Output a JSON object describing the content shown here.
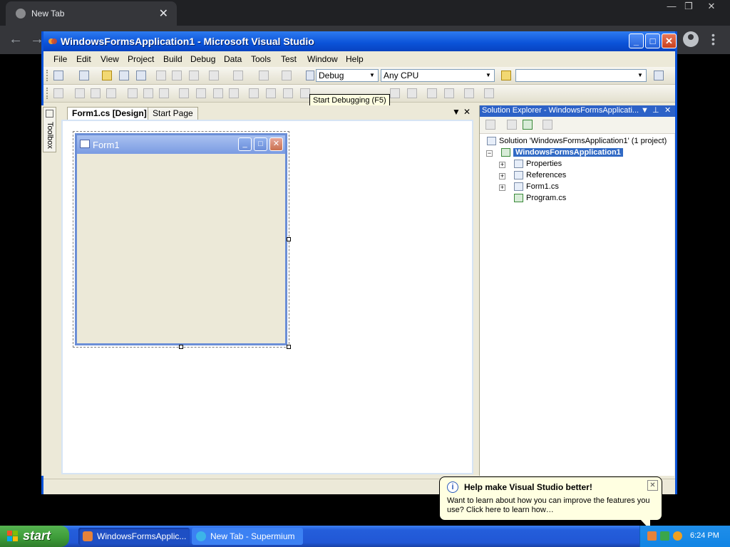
{
  "browser": {
    "tab_title": "New Tab",
    "tab_close": "✕",
    "min": "—",
    "restore": "❐",
    "close": "✕",
    "back": "←",
    "forward": "→"
  },
  "vs": {
    "title": "WindowsFormsApplication1 - Microsoft Visual Studio",
    "menu": [
      "File",
      "Edit",
      "View",
      "Project",
      "Build",
      "Debug",
      "Data",
      "Tools",
      "Test",
      "Window",
      "Help"
    ],
    "config": "Debug",
    "platform": "Any CPU",
    "tooltip": "Start Debugging (F5)",
    "toolbox_label": "Toolbox",
    "doc_tabs": [
      "Form1.cs [Design]",
      "Start Page"
    ],
    "form_title": "Form1"
  },
  "solution_explorer": {
    "title": "Solution Explorer - WindowsFormsApplicati...",
    "solution": "Solution 'WindowsFormsApplication1' (1 project)",
    "project": "WindowsFormsApplication1",
    "items": [
      "Properties",
      "References",
      "Form1.cs",
      "Program.cs"
    ]
  },
  "balloon": {
    "title": "Help make Visual Studio better!",
    "body": "Want to learn about how you can improve the features you use? Click here to learn how…"
  },
  "taskbar": {
    "start": "start",
    "task1": "WindowsFormsApplic...",
    "task2": "New Tab - Supermium",
    "clock": "6:24 PM"
  }
}
